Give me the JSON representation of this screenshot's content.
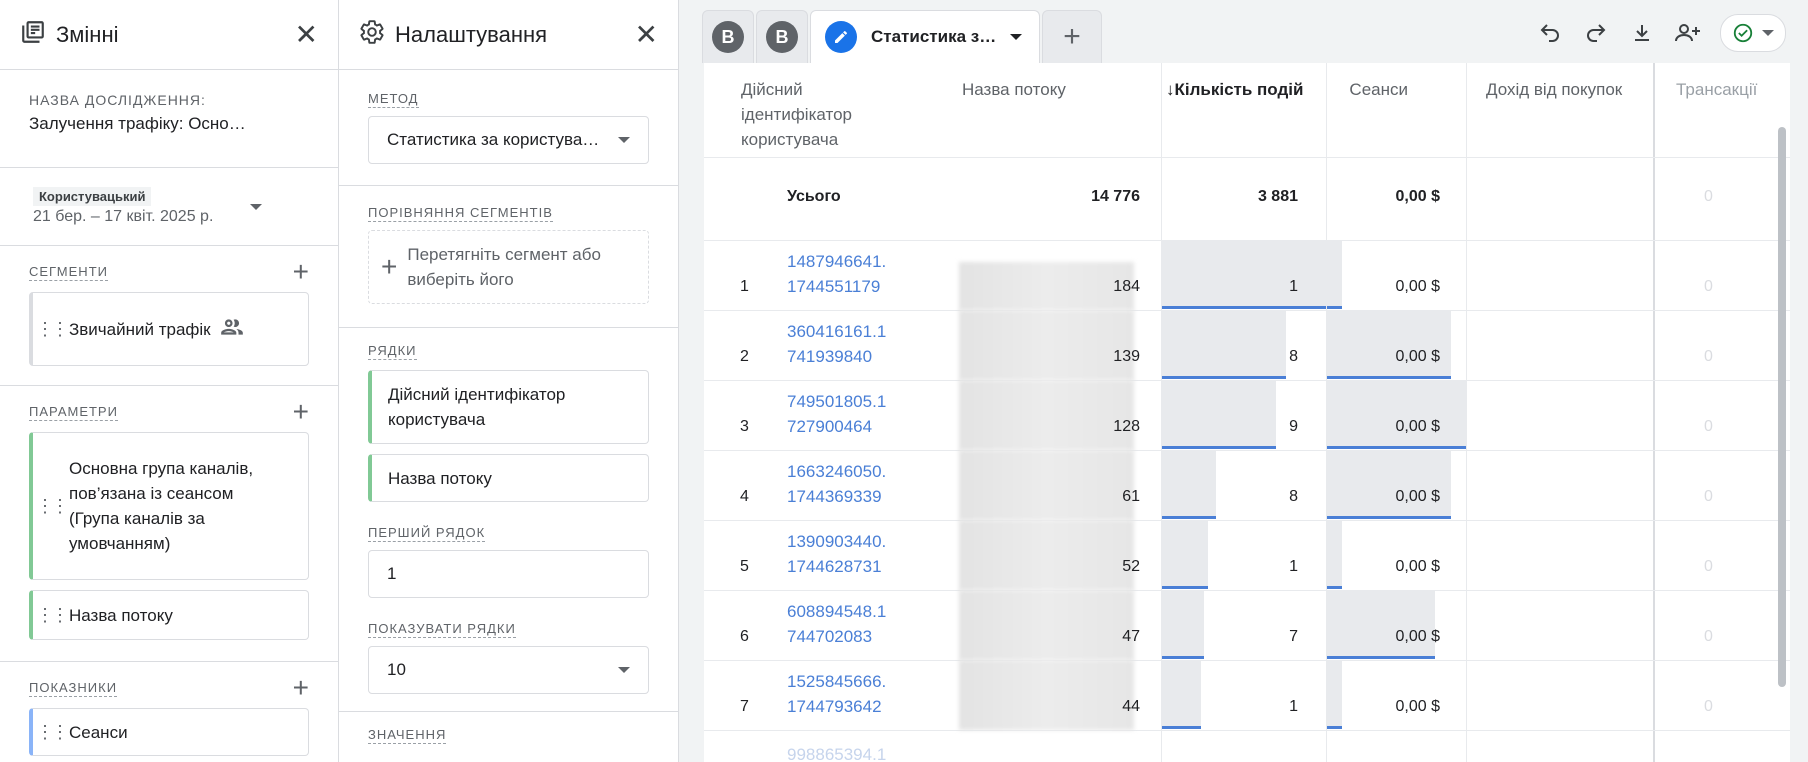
{
  "variables": {
    "title": "Змінні",
    "exploration_label": "НАЗВА ДОСЛІДЖЕННЯ:",
    "exploration_name": "Залучення трафіку: Осно…",
    "date_badge": "Користувацький",
    "date_range": "21 бер. – 17 квіт. 2025 р.",
    "segments_label": "СЕГМЕНТИ",
    "segments": [
      "Звичайний трафік"
    ],
    "dimensions_label": "ПАРАМЕТРИ",
    "dimensions": [
      "Основна група каналів, пов’язана із сеансом (Група каналів за умовчанням)",
      "Назва потоку"
    ],
    "metrics_label": "ПОКАЗНИКИ",
    "metrics": [
      "Сеанси"
    ]
  },
  "settings": {
    "title": "Налаштування",
    "method_label": "МЕТОД",
    "method_value": "Статистика за користува…",
    "compare_label": "ПОРІВНЯННЯ СЕГМЕНТІВ",
    "compare_placeholder": "Перетягніть сегмент або виберіть його",
    "rows_label": "РЯДКИ",
    "rows": [
      "Дійсний ідентифікатор користувача",
      "Назва потоку"
    ],
    "first_row_label": "ПЕРШИЙ РЯДОК",
    "first_row_value": "1",
    "show_rows_label": "ПОКАЗУВАТИ РЯДКИ",
    "show_rows_value": "10",
    "values_label": "ЗНАЧЕННЯ"
  },
  "tabs": {
    "tab1": "B",
    "tab2": "B",
    "active": "Статистика з…"
  },
  "colors": {
    "accent": "#1a73e8",
    "bar": "#e8eaed",
    "underline": "#4a7fd6",
    "green": "#81c995",
    "blue_chip": "#8ab4f8"
  },
  "table": {
    "headers": {
      "user_id": "Дійсний ідентифікатор користувача",
      "stream": "Назва потоку",
      "events": "Кількість подій",
      "sessions": "Сеанси",
      "revenue": "Дохід від покупок",
      "transactions": "Трансакції"
    },
    "total_label": "Усього",
    "total_events": "14 776",
    "total_sessions": "3 881",
    "total_revenue": "0,00 $",
    "total_transactions": "0",
    "rows": [
      {
        "n": "1",
        "id1": "1487946641.",
        "id2": "1744551179",
        "events": "184",
        "sessions": "1",
        "revenue": "0,00 $",
        "tx": "0",
        "ev_frac": 1.0,
        "se_frac": 0.11
      },
      {
        "n": "2",
        "id1": "360416161.1",
        "id2": "741939840",
        "events": "139",
        "sessions": "8",
        "revenue": "0,00 $",
        "tx": "0",
        "ev_frac": 0.755,
        "se_frac": 0.889
      },
      {
        "n": "3",
        "id1": "749501805.1",
        "id2": "727900464",
        "events": "128",
        "sessions": "9",
        "revenue": "0,00 $",
        "tx": "0",
        "ev_frac": 0.696,
        "se_frac": 1.0
      },
      {
        "n": "4",
        "id1": "1663246050.",
        "id2": "1744369339",
        "events": "61",
        "sessions": "8",
        "revenue": "0,00 $",
        "tx": "0",
        "ev_frac": 0.332,
        "se_frac": 0.889
      },
      {
        "n": "5",
        "id1": "1390903440.",
        "id2": "1744628731",
        "events": "52",
        "sessions": "1",
        "revenue": "0,00 $",
        "tx": "0",
        "ev_frac": 0.283,
        "se_frac": 0.11
      },
      {
        "n": "6",
        "id1": "608894548.1",
        "id2": "744702083",
        "events": "47",
        "sessions": "7",
        "revenue": "0,00 $",
        "tx": "0",
        "ev_frac": 0.255,
        "se_frac": 0.778
      },
      {
        "n": "7",
        "id1": "1525845666.",
        "id2": "1744793642",
        "events": "44",
        "sessions": "1",
        "revenue": "0,00 $",
        "tx": "0",
        "ev_frac": 0.239,
        "se_frac": 0.11
      }
    ],
    "partial_row_id": "998865394.1"
  }
}
